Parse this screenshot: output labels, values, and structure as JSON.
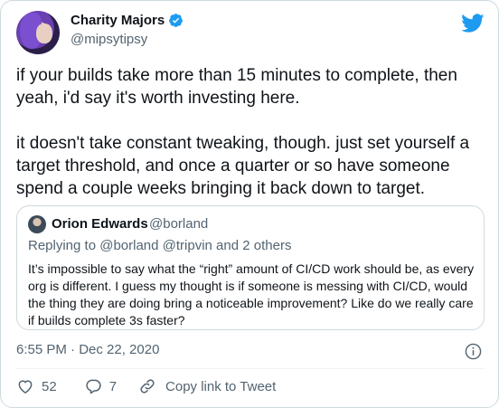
{
  "author": {
    "name": "Charity Majors",
    "handle": "@mipsytipsy"
  },
  "tweet": {
    "text": "if your builds take more than 15 minutes to complete, then\nyeah, i'd say it's worth investing here.\n\nit doesn't take constant tweaking, though. just set yourself a\ntarget threshold, and once a quarter or so have someone\nspend a couple weeks bringing it back down to target."
  },
  "quote": {
    "name": "Orion Edwards",
    "handle": "@borland",
    "replying": "Replying to @borland @tripvin and 2 others",
    "text": "It’s impossible to say what the “right” amount of CI/CD work should be, as every org is different. I guess my thought is if someone is messing with CI/CD, would the thing they are doing bring a noticeable improvement? Like do we really care if builds complete 3s faster?"
  },
  "meta": {
    "timestamp": "6:55 PM · Dec 22, 2020"
  },
  "actions": {
    "likes": "52",
    "replies": "7",
    "copy_link": "Copy link to Tweet"
  },
  "icons": {
    "brand": "twitter-bird-icon",
    "verified": "verified-badge-icon",
    "info": "info-icon",
    "like": "heart-icon",
    "reply": "reply-bubble-icon",
    "link": "link-icon"
  },
  "colors": {
    "brand_blue": "#1d9bf0",
    "secondary_text": "#536471",
    "border": "#cfd9de",
    "text": "#0f1419"
  }
}
